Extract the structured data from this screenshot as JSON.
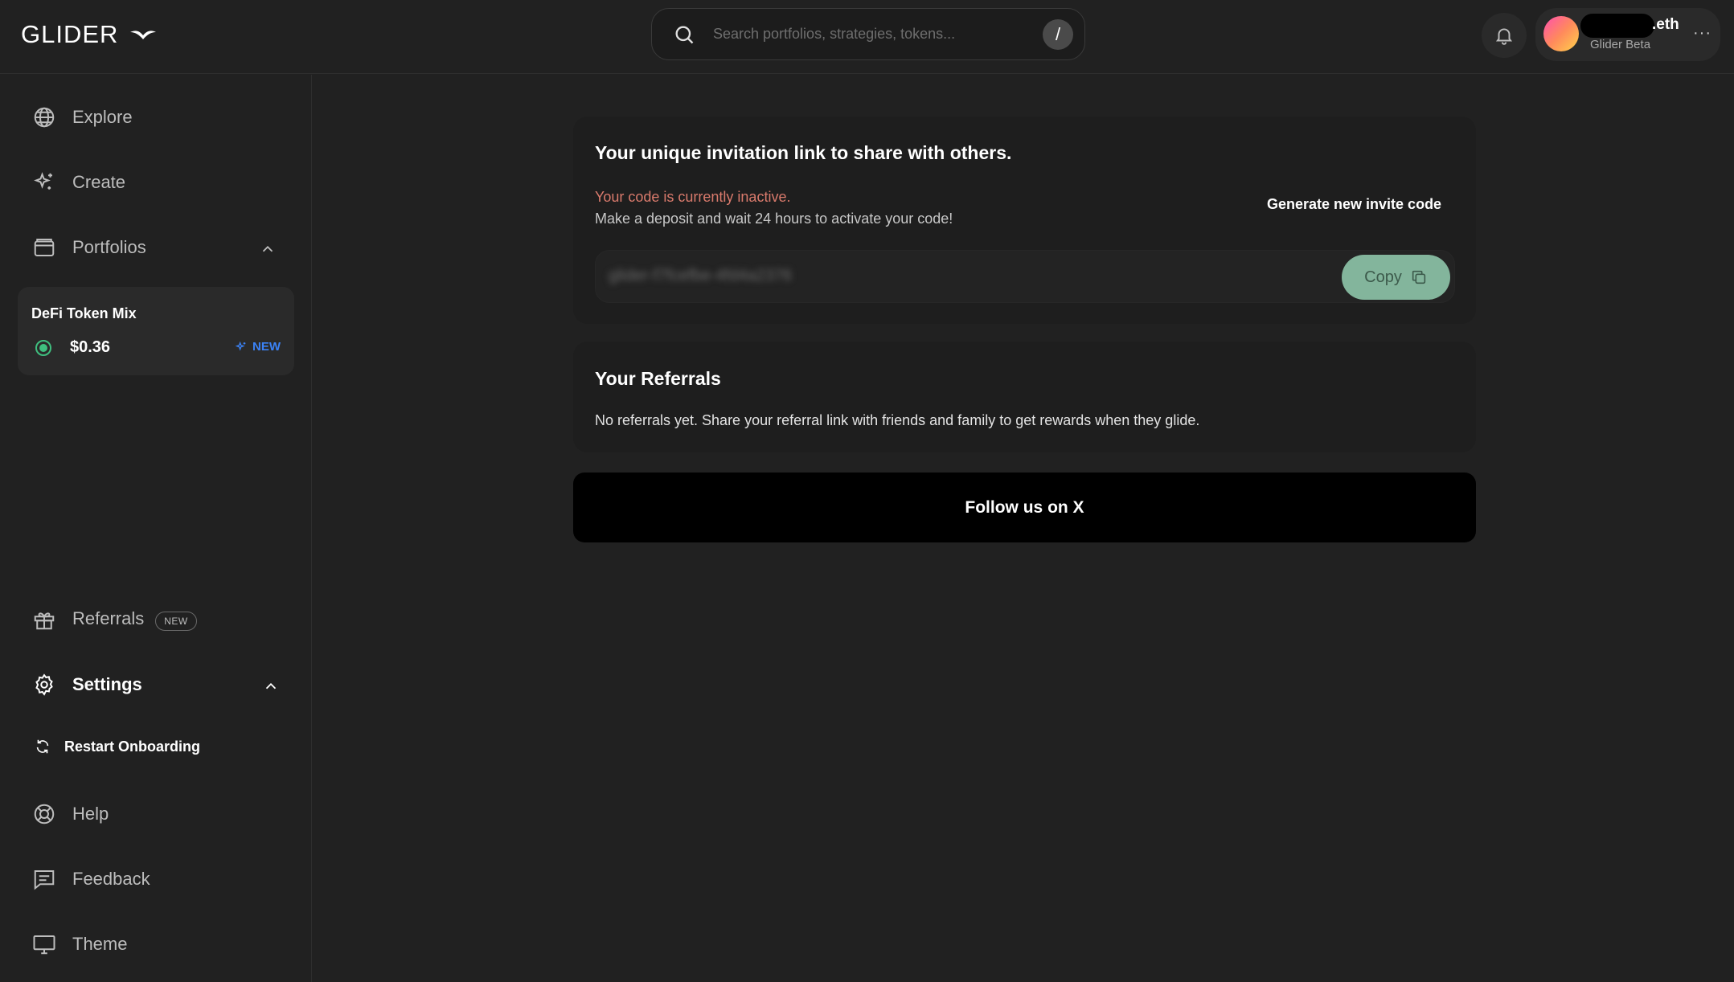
{
  "header": {
    "logo_text": "GLIDER",
    "search_placeholder": "Search portfolios, strategies, tokens...",
    "search_shortcut": "/",
    "user_suffix": ".eth",
    "user_subtitle": "Glider Beta",
    "more_label": "···"
  },
  "sidebar": {
    "explore": "Explore",
    "create": "Create",
    "portfolios": "Portfolios",
    "portfolio_card": {
      "name": "DeFi Token Mix",
      "value": "$0.36",
      "new_label": "NEW"
    },
    "referrals": "Referrals",
    "referrals_badge": "NEW",
    "settings": "Settings",
    "restart_onboarding": "Restart Onboarding",
    "help": "Help",
    "feedback": "Feedback",
    "theme": "Theme"
  },
  "invite": {
    "title": "Your unique invitation link to share with others.",
    "inactive_msg": "Your code is currently inactive.",
    "deposit_msg": "Make a deposit and wait 24 hours to activate your code!",
    "generate_label": "Generate new invite code",
    "link_value": "glider-f7fcefbe-4fd4a2376",
    "copy_label": "Copy"
  },
  "referrals": {
    "title": "Your Referrals",
    "empty_msg": "No referrals yet. Share your referral link with friends and family to get rewards when they glide."
  },
  "follow": {
    "label": "Follow us on X"
  },
  "colors": {
    "background": "#212121",
    "card": "#1e1e1e",
    "inactive_text": "#d97a6c",
    "copy_button": "#83b59c",
    "new_accent": "#3b82f6",
    "status_green": "#3fbf7f"
  }
}
